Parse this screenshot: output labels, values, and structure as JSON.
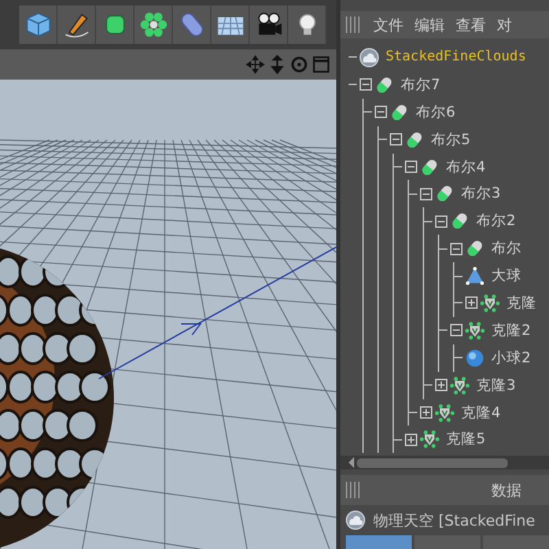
{
  "object_manager": {
    "menu": [
      "文件",
      "编辑",
      "查看",
      "对"
    ],
    "tree": [
      {
        "label": "StackedFineClouds",
        "kind": "sky",
        "highlight": true
      },
      {
        "label": "布尔7",
        "kind": "boole",
        "expanded": true,
        "children": [
          {
            "label": "布尔6",
            "kind": "boole",
            "expanded": true,
            "children": [
              {
                "label": "布尔5",
                "kind": "boole",
                "expanded": true,
                "children": [
                  {
                    "label": "布尔4",
                    "kind": "boole",
                    "expanded": true,
                    "children": [
                      {
                        "label": "布尔3",
                        "kind": "boole",
                        "expanded": true,
                        "children": [
                          {
                            "label": "布尔2",
                            "kind": "boole",
                            "expanded": true,
                            "children": [
                              {
                                "label": "布尔",
                                "kind": "boole",
                                "expanded": true,
                                "children": [
                                  {
                                    "label": "大球",
                                    "kind": "cone"
                                  },
                                  {
                                    "label": "克隆",
                                    "kind": "cloner",
                                    "expanded": false
                                  }
                                ]
                              },
                              {
                                "label": "克隆2",
                                "kind": "cloner",
                                "expanded": true,
                                "children": [
                                  {
                                    "label": "小球2",
                                    "kind": "sphere"
                                  }
                                ]
                              }
                            ]
                          },
                          {
                            "label": "克隆3",
                            "kind": "cloner",
                            "expanded": false
                          }
                        ]
                      },
                      {
                        "label": "克隆4",
                        "kind": "cloner",
                        "expanded": false
                      }
                    ]
                  },
                  {
                    "label": "克隆5",
                    "kind": "cloner",
                    "expanded": false
                  }
                ]
              }
            ]
          }
        ]
      }
    ]
  },
  "attributes": {
    "menu": [
      "数据"
    ],
    "object": "物理天空 [StackedFine",
    "tabs": [
      {
        "selected": true
      },
      {
        "selected": false
      },
      {
        "selected": false
      }
    ]
  }
}
